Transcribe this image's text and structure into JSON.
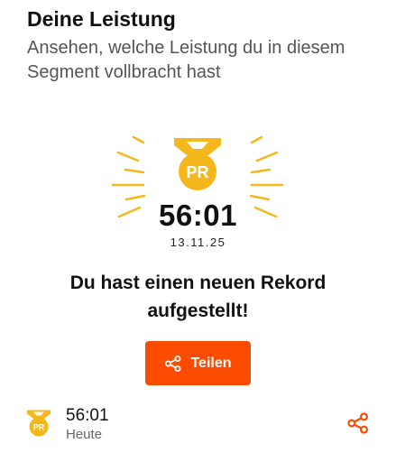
{
  "header": {
    "title": "Deine Leistung",
    "subtitle": "Ansehen, welche Leistung du in diesem Segment vollbracht hast"
  },
  "badge": {
    "icon": "pr-medal-icon",
    "label": "PR",
    "color": "#f5b81c"
  },
  "record": {
    "time": "56:01",
    "date": "13.11.25",
    "message": "Du hast einen neuen Rekord aufgestellt!"
  },
  "share_button": {
    "label": "Teilen",
    "icon": "share-icon",
    "color": "#fc4c02"
  },
  "effort": {
    "time": "56:01",
    "day": "Heute",
    "badge_label": "PR",
    "share_icon": "share-icon"
  }
}
